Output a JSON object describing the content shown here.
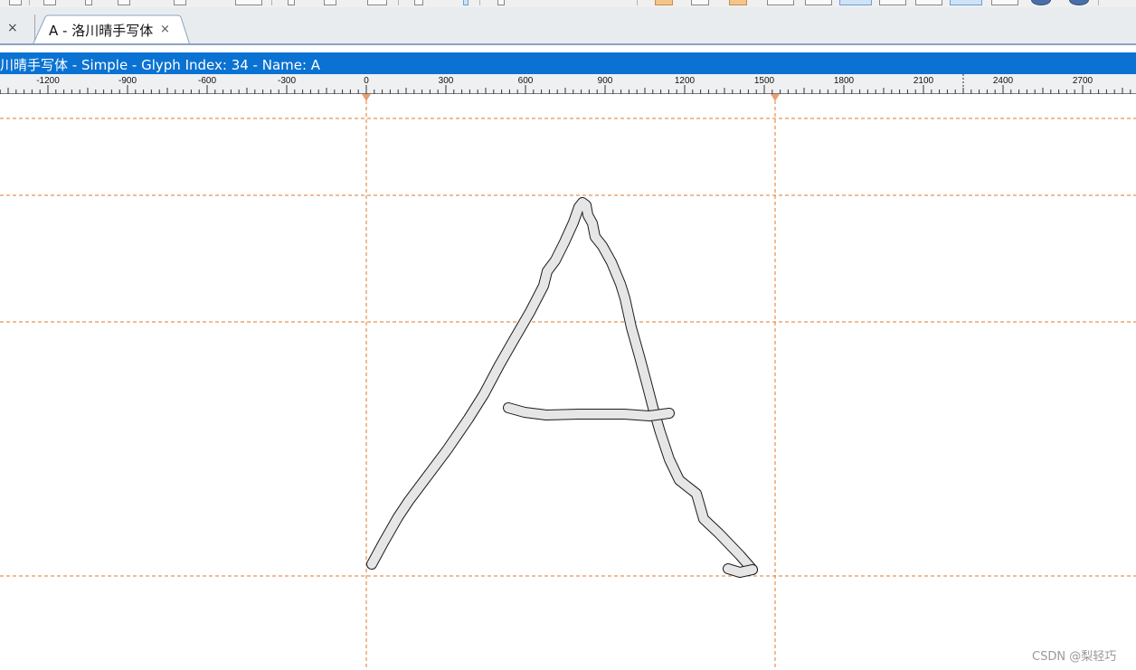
{
  "toolbar": {
    "icons": [
      "file-icon",
      "document-icon",
      "print-icon",
      "copy-icon",
      "paste-icon",
      "grid-icon",
      "rotate-icon",
      "pen-icon",
      "arrow-icon",
      "folder-icon",
      "page-icon",
      "folder-open-icon",
      "glyph-grid-icon",
      "glyph-curve-icon",
      "glyph-grid-selected-icon",
      "glyph-curve-red-icon",
      "glyph-point-icon",
      "glyph-grid-active-icon",
      "glyph-point-orange-icon",
      "globe-icon",
      "globe-small-icon"
    ]
  },
  "tabs": {
    "previous_close": "×",
    "active_label": "A - 洛川晴手写体",
    "active_close": "×"
  },
  "title_bar": {
    "text": "川晴手写体 - Simple - Glyph Index: 34 - Name: A"
  },
  "ruler": {
    "labels": [
      "-1200",
      "-900",
      "-600",
      "-300",
      "0",
      "300",
      "600",
      "900",
      "1200",
      "1500",
      "1800",
      "2100",
      "2400",
      "2700"
    ]
  },
  "glyph": {
    "name": "A",
    "index": 34,
    "fill_color": "#e6e6e6",
    "outline_color": "#222222"
  },
  "guides": {
    "color": "#e07a28"
  },
  "watermark": "CSDN @梨轻巧"
}
